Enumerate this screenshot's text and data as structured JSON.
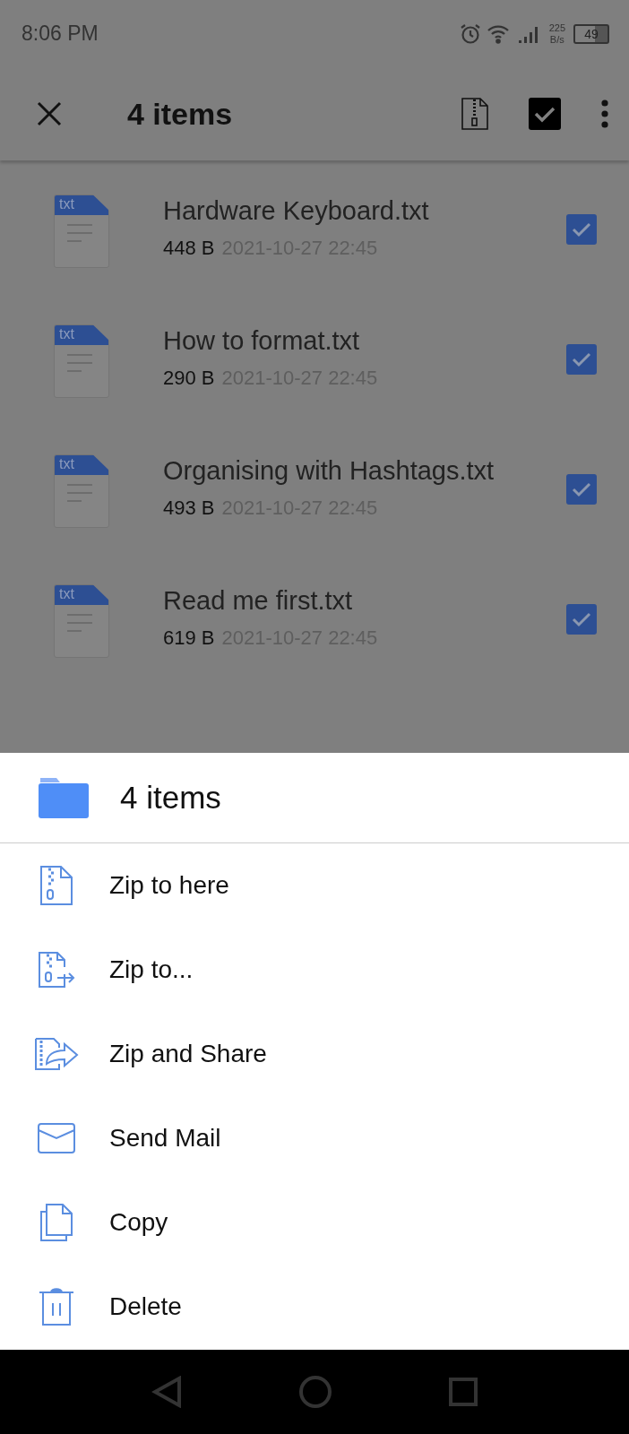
{
  "status_bar": {
    "time": "8:06 PM",
    "speed_value": "225",
    "speed_unit": "B/s",
    "battery": "49"
  },
  "app_bar": {
    "title": "4 items"
  },
  "files": [
    {
      "icon_label": "txt",
      "name": "Hardware Keyboard.txt",
      "size": "448 B",
      "date": "2021-10-27 22:45",
      "checked": true
    },
    {
      "icon_label": "txt",
      "name": "How to format.txt",
      "size": "290 B",
      "date": "2021-10-27 22:45",
      "checked": true
    },
    {
      "icon_label": "txt",
      "name": "Organising with Hashtags.txt",
      "size": "493 B",
      "date": "2021-10-27 22:45",
      "checked": true
    },
    {
      "icon_label": "txt",
      "name": "Read me first.txt",
      "size": "619 B",
      "date": "2021-10-27 22:45",
      "checked": true
    }
  ],
  "sheet": {
    "title": "4 items",
    "actions": [
      {
        "kind": "zip",
        "label": "Zip to here"
      },
      {
        "kind": "zip-to",
        "label": "Zip to..."
      },
      {
        "kind": "zip-share",
        "label": "Zip and Share"
      },
      {
        "kind": "mail",
        "label": "Send Mail"
      },
      {
        "kind": "copy",
        "label": "Copy"
      },
      {
        "kind": "delete",
        "label": "Delete"
      }
    ]
  }
}
